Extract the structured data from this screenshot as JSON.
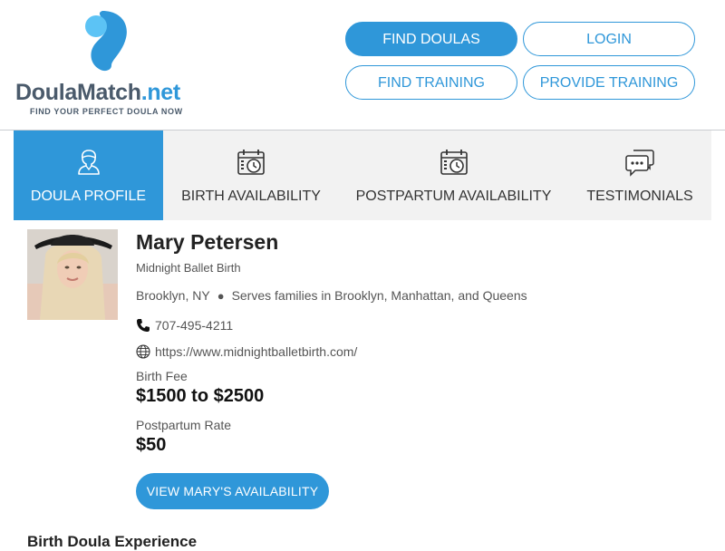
{
  "brand": {
    "name_part1": "Doula",
    "name_part2": "Match",
    "name_part3": ".net",
    "tagline": "FIND YOUR PERFECT DOULA NOW",
    "color_primary": "#2f97d9",
    "color_dark": "#4a5a6b"
  },
  "nav": {
    "find_doulas": "FIND DOULAS",
    "login": "LOGIN",
    "find_training": "FIND TRAINING",
    "provide_training": "PROVIDE TRAINING"
  },
  "tabs": [
    {
      "label": "DOULA PROFILE",
      "icon": "person-icon",
      "active": true
    },
    {
      "label": "BIRTH AVAILABILITY",
      "icon": "calendar-clock-icon",
      "active": false
    },
    {
      "label": "POSTPARTUM AVAILABILITY",
      "icon": "calendar-clock-icon",
      "active": false
    },
    {
      "label": "TESTIMONIALS",
      "icon": "chat-bubbles-icon",
      "active": false
    }
  ],
  "profile": {
    "name": "Mary Petersen",
    "business": "Midnight Ballet Birth",
    "location": "Brooklyn, NY",
    "service_area": "Serves families in Brooklyn, Manhattan, and Queens",
    "phone": "707-495-4211",
    "website": "https://www.midnightballetbirth.com/",
    "birth_fee_label": "Birth Fee",
    "birth_fee": "$1500 to $2500",
    "postpartum_rate_label": "Postpartum Rate",
    "postpartum_rate": "$50",
    "availability_button": "VIEW MARY'S AVAILABILITY"
  },
  "sections": {
    "birth_experience": "Birth Doula Experience"
  }
}
